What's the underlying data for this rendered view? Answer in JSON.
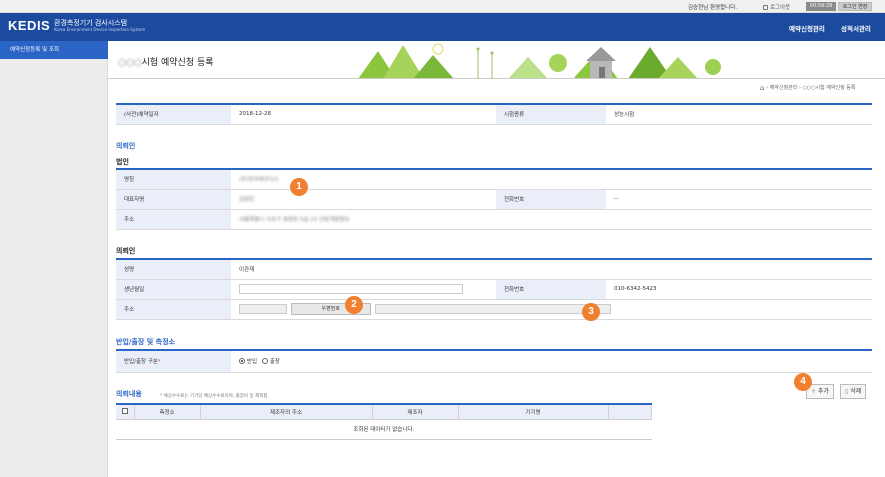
{
  "topbar": {
    "welcome": "김승현님 환영합니다.",
    "logout": "로그아웃",
    "timer": "00:59:29",
    "extend": "로그인 연장"
  },
  "header": {
    "logo": "KEDIS",
    "system_name": "환경측정기기 검사시스템",
    "system_name_en": "Korea Environment Device Inspection System",
    "nav": [
      "예약신청관리",
      "성적서관리"
    ]
  },
  "sidebar": {
    "active_item": "예약신청등록 및 조회"
  },
  "page": {
    "title": "시험 예약신청 등록",
    "title_prefix_blurred": "○○○",
    "breadcrumb": [
      "예약신청관리",
      "○○○시험 예약신청 등록"
    ]
  },
  "reservation": {
    "date_label": "(사전)예약일자",
    "date_value": "2018-12-28",
    "type_label": "시험종류",
    "type_value": "성능시험"
  },
  "client_section": {
    "title": "의뢰인",
    "corp_title": "법인",
    "corp_name_label": "명칭",
    "corp_name_value": "(주)한국테크닉스",
    "rep_label": "대표자명",
    "rep_value": "김현민",
    "corp_phone_label": "전화번호",
    "corp_phone_value": "--",
    "corp_addr_label": "주소",
    "corp_addr_value": "서울특별시 서초구 효령로 5길 23 산림개발빌딩",
    "person_title": "의뢰인",
    "name_label": "성명",
    "name_value": "이관재",
    "birth_label": "생년월일",
    "phone_label": "전화번호",
    "phone_value": "010-6342-5423",
    "addr_label": "주소",
    "zip_button": "우편번호"
  },
  "location_section": {
    "title": "반입/출장 및 측정소",
    "type_label": "반입/출장 구분",
    "required_mark": "*",
    "options": [
      "반입",
      "출장"
    ],
    "selected": "반입"
  },
  "request_section": {
    "title": "의뢰내용",
    "note": "* 예상수수료는 기기당 예상수수료이며, 출장비 등 제외됨.",
    "add_button": "추가",
    "delete_button": "삭제",
    "columns": [
      "측정소",
      "제조자의 주소",
      "제조자",
      "기기명"
    ],
    "empty_message": "조회된 데이터가 없습니다."
  },
  "markers": [
    "1",
    "2",
    "3",
    "4"
  ],
  "colors": {
    "header_blue": "#1b4a9e",
    "accent_blue": "#2a64c4",
    "label_bg": "#e9eef8",
    "marker_orange": "#f08030"
  }
}
